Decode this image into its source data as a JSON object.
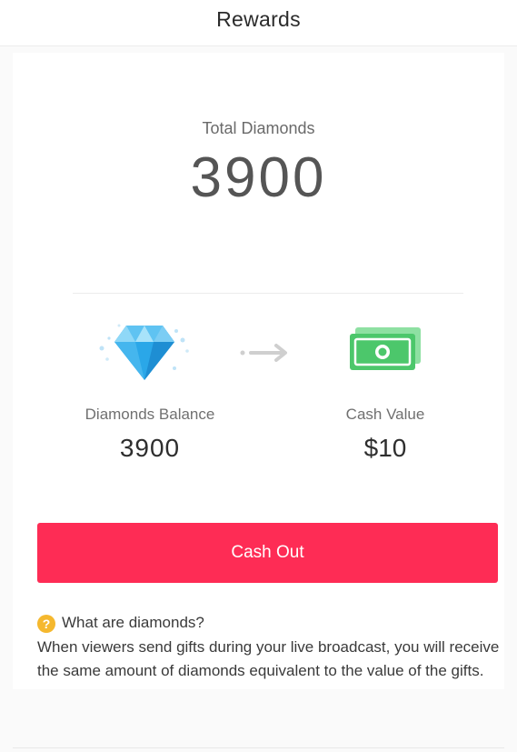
{
  "header": {
    "title": "Rewards"
  },
  "summary": {
    "total_label": "Total Diamonds",
    "total_value": "3900"
  },
  "conversion": {
    "diamond_icon": "diamond-icon",
    "arrow_icon": "arrow-right-icon",
    "cash_icon": "cash-icon",
    "balance_label": "Diamonds Balance",
    "balance_value": "3900",
    "cash_label": "Cash Value",
    "cash_value": "$10"
  },
  "actions": {
    "cash_out_label": "Cash Out"
  },
  "faq": {
    "icon_glyph": "?",
    "question": "What are diamonds?",
    "answer": "When viewers send gifts during your live broadcast, you will receive the same amount of diamonds equivalent to the value of the gifts."
  },
  "colors": {
    "accent": "#fe2c55",
    "diamond": "#2aa7e8",
    "cash": "#4cc76b",
    "help_icon": "#f5b82e"
  }
}
